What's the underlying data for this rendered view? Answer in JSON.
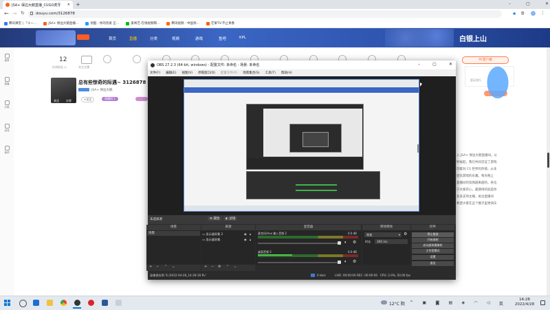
{
  "browser": {
    "tab_title": "JSA+ 保边大鹅直播_CUGO虎牙",
    "url": "douyu.com/3126878",
    "bookmarks": [
      "腾讯课堂 | 「十一…",
      "JSA+ 保边大鹅直播…",
      "优酷 - 你的热爱 正…",
      "爱奇艺-在线视频网…",
      "腾讯视频 - 中国领…",
      "芒果TV-不止青春"
    ],
    "colors": {
      "accent": "#f26522"
    }
  },
  "douyu": {
    "nav": [
      "首页",
      "直播",
      "分类",
      "视频",
      "游戏",
      "鱼吧",
      "KPL"
    ],
    "banner_right": "白银上山",
    "left_nav": [
      "推荐",
      "直播",
      "分类",
      "游戏",
      "鱼吧",
      "赛事"
    ],
    "top_stats": {
      "count": "12",
      "count_label": "在线粉丝 ◎",
      "followed": "关注主播"
    },
    "room_title": "总有些惊奇的际遇~ 3126878",
    "streamer": "JSA+ 保边大鹅",
    "tag1": "+关注",
    "badge1": "直播间 1",
    "btn_follow": "关注",
    "btn_share": "分享",
    "side_label": "PC客户端",
    "side_box": "暂无排行",
    "desc_lines": [
      "入 JSA+ 保边大鹅直播间。从",
      "时候起，我们共同见证了游戏",
      "玩家对 CS 世界的热情，从未",
      "团队游戏的乐趣。每天晚上",
      "直播间的氛围越来越热，各位",
      "宁大家开心，最期待的就是你",
      "多多支持主播，关注直播间",
      "希望大家在这个圈子里更快乐"
    ]
  },
  "obs": {
    "title": "OBS 27.2.3 (64-bit, windows) - 配置文件: 未命名 - 场景: 未命名",
    "menu": [
      "文件(F)",
      "编辑(E)",
      "视图(V)",
      "停靠窗口(D)",
      "配置文件(P)",
      "场景集合(S)",
      "工具(T)",
      "帮助(H)"
    ],
    "no_source": "未选择源",
    "props": "属性",
    "filters": "滤镜",
    "docks": {
      "scenes": "场景",
      "sources": "来源",
      "mixer": "混音器",
      "transitions": "转场特效",
      "controls": "控件"
    },
    "scene_items": [
      "场景"
    ],
    "source_items": [
      "显示器采集 2",
      "显示器采集"
    ],
    "mixer": [
      {
        "label": "麦克风/Aux 输入音频 2",
        "db": "0.0 dB"
      },
      {
        "label": "桌面音频 2",
        "db": "0.0 dB"
      }
    ],
    "transition": {
      "type": "渐变",
      "duration_label": "时长",
      "duration": "300 ms"
    },
    "controls": [
      "停止推流",
      "开始录制",
      "启动虚拟摄像机",
      "工作室模式",
      "设置",
      "退出"
    ],
    "status": {
      "message": "录像保存到 'E:/2022-04-28_14-28-16.flv'",
      "kbps": "0 kb/s",
      "live": "LIVE: 00:00:00",
      "rec": "REC: 00:00:00",
      "cpu": "CPU: 2.0%, 50.00 fps"
    }
  },
  "taskbar": {
    "weather": "12°C 阴",
    "time": "14:28",
    "date": "2022/4/28"
  }
}
